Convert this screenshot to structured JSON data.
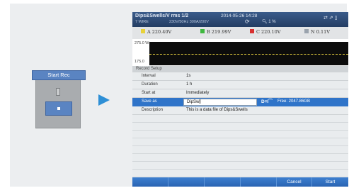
{
  "device": {
    "header_label": "Start Rec"
  },
  "screen": {
    "title": "Dips&Swells/V rms 1/2",
    "subtitle": "7 WIRE",
    "subtitle2": "230V/50Hz  300A/200V",
    "timestamp": "2014-05-26 14:28",
    "zoom_label": "1 %",
    "status_icons": "⇄ ⇗ ▯"
  },
  "legend": [
    {
      "label": "A  220.40V",
      "color": "#e8d23a"
    },
    {
      "label": "B  219.99V",
      "color": "#3fb83f"
    },
    {
      "label": "C  220.10V",
      "color": "#d93030"
    },
    {
      "label": "N  0.11V",
      "color": "#9aa3ad"
    }
  ],
  "plot": {
    "ytop": "275.0 W",
    "ybottom": "175.0"
  },
  "dialog": {
    "title": "Record Setup",
    "interval": {
      "label": "Interval",
      "value": "1s"
    },
    "duration": {
      "label": "Duration",
      "value": "1 h"
    },
    "start_at": {
      "label": "Start at",
      "value": "Immediately"
    },
    "save_as": {
      "label": "Save as",
      "value": "DipSw"
    },
    "save_icon": "D≡I⁀",
    "free_text": "Free: 2047.86GB",
    "description": {
      "label": "Description",
      "value": "This is a data file of Dips&Swells"
    }
  },
  "footer": {
    "cancel": "Cancel",
    "start": "Start"
  }
}
